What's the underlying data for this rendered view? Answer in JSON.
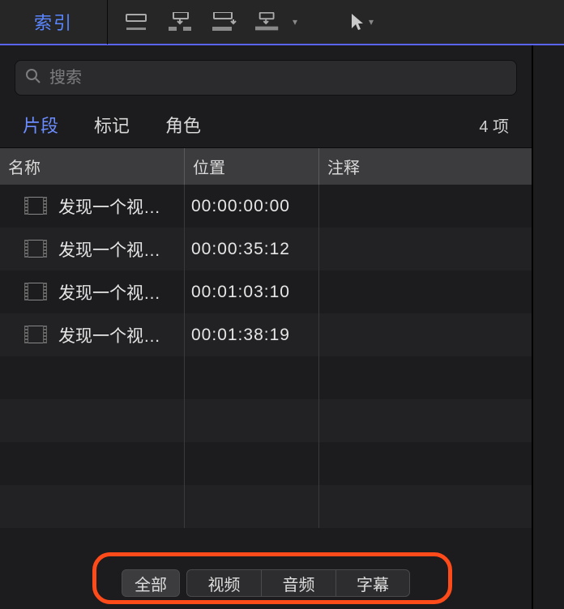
{
  "topbar": {
    "index_label": "索引"
  },
  "search": {
    "placeholder": "搜索"
  },
  "tabs": {
    "clips": "片段",
    "markers": "标记",
    "roles": "角色"
  },
  "count": "4 项",
  "columns": {
    "name": "名称",
    "position": "位置",
    "notes": "注释"
  },
  "rows": [
    {
      "name": "发现一个视…",
      "pos": "00:00:00:00",
      "note": ""
    },
    {
      "name": "发现一个视…",
      "pos": "00:00:35:12",
      "note": ""
    },
    {
      "name": "发现一个视…",
      "pos": "00:01:03:10",
      "note": ""
    },
    {
      "name": "发现一个视…",
      "pos": "00:01:38:19",
      "note": ""
    }
  ],
  "footer": {
    "all": "全部",
    "video": "视频",
    "audio": "音频",
    "subtitle": "字幕"
  }
}
